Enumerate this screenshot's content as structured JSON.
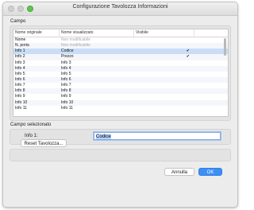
{
  "window": {
    "title": "Configurazione Tavolozza Informazioni"
  },
  "campo": {
    "section_label": "Campo",
    "columns": [
      "Nome originale",
      "Nome visualizzato",
      "Visibile"
    ],
    "rows": [
      {
        "original": "Nome",
        "display": "Non modificabile",
        "visible": "",
        "muted": true,
        "selected": false
      },
      {
        "original": "N. porta",
        "display": "Non modificabile",
        "visible": "",
        "muted": true,
        "selected": false
      },
      {
        "original": "Info 1",
        "display": "Codice",
        "visible": "✔",
        "muted": false,
        "selected": true
      },
      {
        "original": "Info 2",
        "display": "Prezzo",
        "visible": "✔",
        "muted": false,
        "selected": false
      },
      {
        "original": "Info 3",
        "display": "Info 3",
        "visible": "",
        "muted": false,
        "selected": false
      },
      {
        "original": "Info 4",
        "display": "Info 4",
        "visible": "",
        "muted": false,
        "selected": false
      },
      {
        "original": "Info 5",
        "display": "Info 5",
        "visible": "",
        "muted": false,
        "selected": false
      },
      {
        "original": "Info 6",
        "display": "Info 6",
        "visible": "",
        "muted": false,
        "selected": false
      },
      {
        "original": "Info 7",
        "display": "Info 7",
        "visible": "",
        "muted": false,
        "selected": false
      },
      {
        "original": "Info 8",
        "display": "Info 8",
        "visible": "",
        "muted": false,
        "selected": false
      },
      {
        "original": "Info 9",
        "display": "Info 9",
        "visible": "",
        "muted": false,
        "selected": false
      },
      {
        "original": "Info 10",
        "display": "Info 10",
        "visible": "",
        "muted": false,
        "selected": false
      },
      {
        "original": "Info 11",
        "display": "Info 11",
        "visible": "",
        "muted": false,
        "selected": false
      }
    ]
  },
  "selected_field": {
    "section_label": "Campo selezionato",
    "label": "Info 1:",
    "value": "Codice"
  },
  "buttons": {
    "reset": "Reset Tavolozza...",
    "cancel": "Annulla",
    "ok": "OK"
  },
  "colors": {
    "accent": "#3d8ff5",
    "selection": "#c9def6",
    "close_light": "#5cc64b"
  }
}
